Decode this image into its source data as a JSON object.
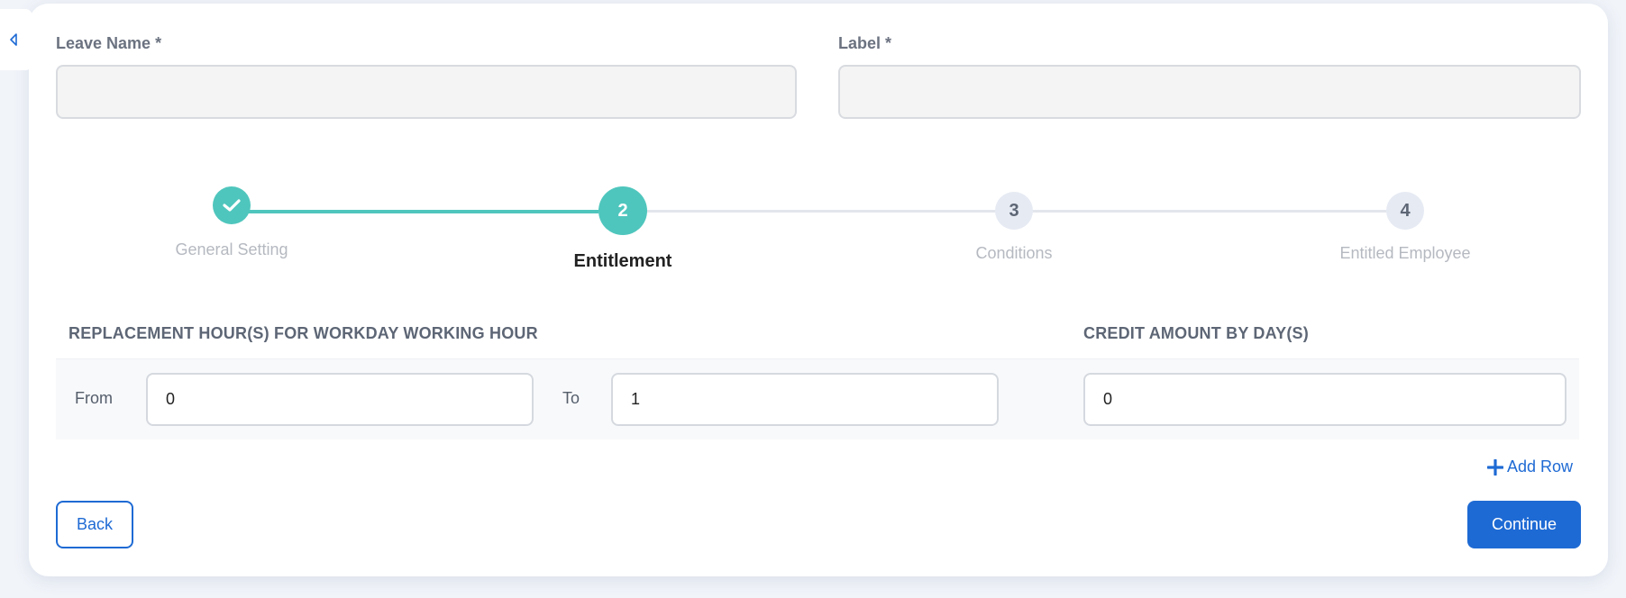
{
  "form": {
    "leave_name_label": "Leave Name *",
    "leave_name_value": "",
    "label_label": "Label *",
    "label_value": ""
  },
  "stepper": {
    "steps": [
      {
        "number": "",
        "label": "General Setting",
        "state": "completed"
      },
      {
        "number": "2",
        "label": "Entitlement",
        "state": "active"
      },
      {
        "number": "3",
        "label": "Conditions",
        "state": "pending"
      },
      {
        "number": "4",
        "label": "Entitled Employee",
        "state": "pending"
      }
    ]
  },
  "entitlement": {
    "replacement_header": "REPLACEMENT HOUR(S) FOR WORKDAY WORKING HOUR",
    "credit_header": "CREDIT AMOUNT BY DAY(S)",
    "rows": [
      {
        "from_label": "From",
        "from_value": "0",
        "to_label": "To",
        "to_value": "1",
        "credit_value": "0"
      }
    ],
    "add_row_label": "Add Row"
  },
  "actions": {
    "back_label": "Back",
    "continue_label": "Continue"
  },
  "colors": {
    "teal": "#4fc6bd",
    "primary_blue": "#1e6ad4",
    "pending_circle": "#e6eaf3"
  }
}
